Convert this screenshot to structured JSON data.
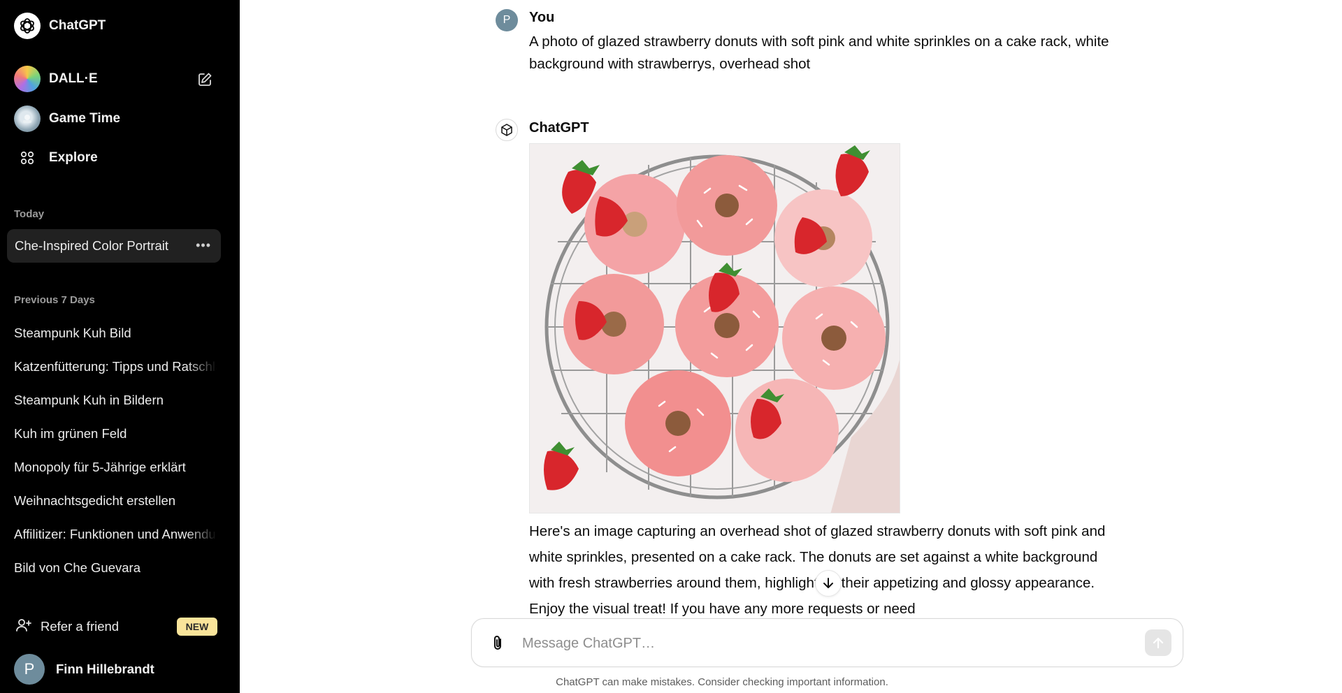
{
  "sidebar": {
    "brand": "ChatGPT",
    "gpts": [
      {
        "label": "DALL·E",
        "icon": "dalle-icon"
      },
      {
        "label": "Game Time",
        "icon": "game-time-icon"
      },
      {
        "label": "Explore",
        "icon": "explore-grid-icon"
      }
    ],
    "today_label": "Today",
    "active_chat": "Che-Inspired Color Portrait",
    "previous_label": "Previous 7 Days",
    "history": [
      "Steampunk Kuh Bild",
      "Katzenfütterung: Tipps und Ratschläge",
      "Steampunk Kuh in Bildern",
      "Kuh im grünen Feld",
      "Monopoly für 5-Jährige erklärt",
      "Weihnachtsgedicht erstellen",
      "Affilitizer: Funktionen und Anwendung",
      "Bild von Che Guevara"
    ],
    "refer_label": "Refer a friend",
    "refer_badge": "NEW",
    "user_initial": "P",
    "user_name": "Finn Hillebrandt"
  },
  "conversation": {
    "user_author": "You",
    "user_initial": "P",
    "user_message": "A photo of glazed strawberry donuts with soft pink and white sprinkles on a cake rack, white background with strawberrys, overhead shot",
    "assistant_author": "ChatGPT",
    "assistant_message": "Here's an image capturing an overhead shot of glazed strawberry donuts with soft pink and white sprinkles, presented on a cake rack. The donuts are set against a white background with fresh strawberries around them, highlighting their appetizing and glossy appearance. Enjoy the visual treat! If you have any more requests or need"
  },
  "composer": {
    "placeholder": "Message ChatGPT…",
    "value": ""
  },
  "disclaimer": "ChatGPT can make mistakes. Consider checking important information.",
  "colors": {
    "sidebar_bg": "#000000",
    "active_chat_bg": "#212121",
    "new_badge_bg": "#f9e49a",
    "avatar_bg": "#6e8c9c",
    "donut_pink": "#f29a9a",
    "strawberry_red": "#d8262c"
  }
}
